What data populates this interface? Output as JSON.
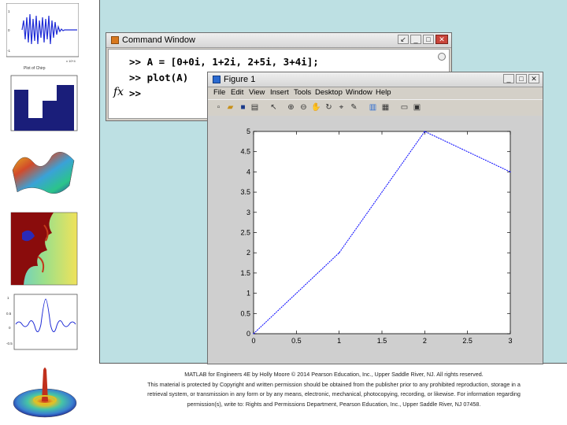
{
  "command_window": {
    "title": "Command Window",
    "lines": [
      ">> A = [0+0i, 1+2i, 2+5i, 3+4i];",
      ">> plot(A)",
      ">>"
    ],
    "fx_label": "fx"
  },
  "figure_window": {
    "title": "Figure 1",
    "menu": [
      "File",
      "Edit",
      "View",
      "Insert",
      "Tools",
      "Desktop",
      "Window",
      "Help"
    ],
    "toolbar_icons": [
      "new-figure-icon",
      "open-file-icon",
      "save-icon",
      "print-icon",
      "arrow-icon",
      "zoom-in-icon",
      "zoom-out-icon",
      "pan-icon",
      "rotate-icon",
      "data-cursor-icon",
      "brush-icon",
      "colorbar-icon",
      "legend-icon",
      "hide-tools-icon",
      "show-tools-icon"
    ]
  },
  "chart_data": {
    "type": "line",
    "x": [
      0,
      1,
      2,
      3
    ],
    "y": [
      0,
      2,
      5,
      4
    ],
    "xlim": [
      0,
      3
    ],
    "ylim": [
      0,
      5
    ],
    "xticks": [
      "0",
      "0.5",
      "1",
      "1.5",
      "2",
      "2.5",
      "3"
    ],
    "yticks": [
      "0",
      "0.5",
      "1",
      "1.5",
      "2",
      "2.5",
      "3",
      "3.5",
      "4",
      "4.5",
      "5"
    ],
    "line_color": "#0000ff",
    "title": "",
    "xlabel": "",
    "ylabel": ""
  },
  "thumbnails": {
    "plot1_axis_label": "Plot of Chirp",
    "plot1_scale": "x 10^4"
  },
  "caption": {
    "line1": "MATLAB for Engineers 4E by Holly Moore © 2014 Pearson Education, Inc., Upper Saddle River, NJ. All rights reserved.",
    "line2": "This material is protected by Copyright and written permission should be obtained from the publisher prior to any prohibited reproduction, storage in a",
    "line3": "retrieval system, or transmission in any form or by any means, electronic, mechanical, photocopying, recording, or likewise. For information regarding",
    "line4": "permission(s), write to: Rights and Permissions Department, Pearson Education, Inc., Upper Saddle River, NJ 07458."
  },
  "colors": {
    "panel_bg": "#bde0e3",
    "window_bg": "#d4d0c8",
    "plot_line": "#0000ff"
  }
}
